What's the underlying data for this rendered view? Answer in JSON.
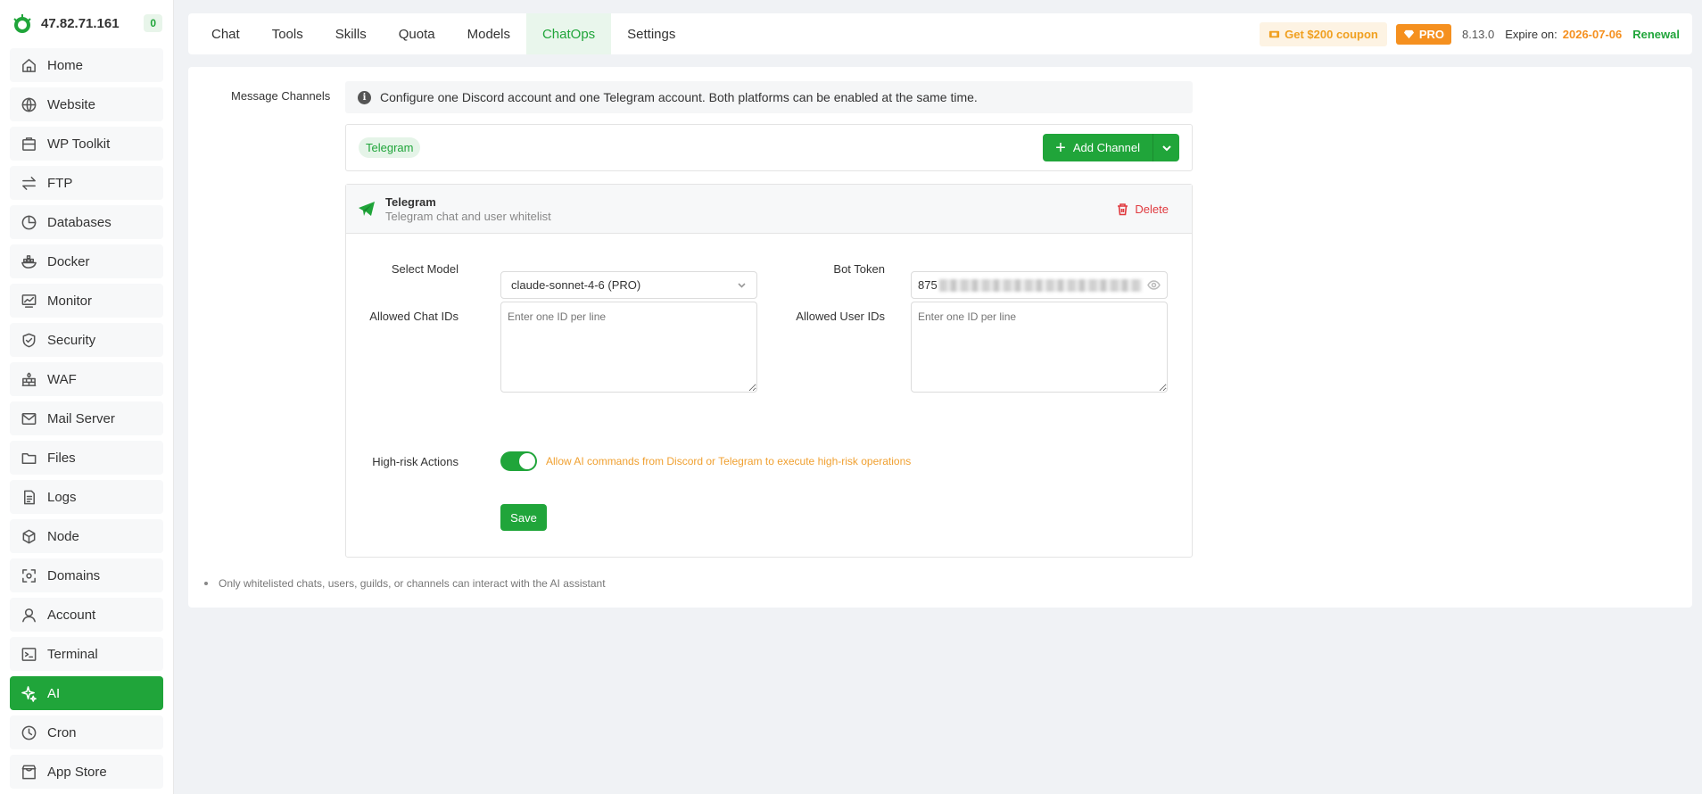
{
  "brand": {
    "ip": "47.82.71.161",
    "badge": "0"
  },
  "sidebar": {
    "items": [
      {
        "label": "Home",
        "icon": "home-icon"
      },
      {
        "label": "Website",
        "icon": "globe-icon"
      },
      {
        "label": "WP Toolkit",
        "icon": "toolkit-icon"
      },
      {
        "label": "FTP",
        "icon": "transfer-icon"
      },
      {
        "label": "Databases",
        "icon": "database-icon"
      },
      {
        "label": "Docker",
        "icon": "docker-icon"
      },
      {
        "label": "Monitor",
        "icon": "monitor-icon"
      },
      {
        "label": "Security",
        "icon": "shield-icon"
      },
      {
        "label": "WAF",
        "icon": "firewall-icon"
      },
      {
        "label": "Mail Server",
        "icon": "mail-icon"
      },
      {
        "label": "Files",
        "icon": "folder-icon"
      },
      {
        "label": "Logs",
        "icon": "log-icon"
      },
      {
        "label": "Node",
        "icon": "node-icon"
      },
      {
        "label": "Domains",
        "icon": "domain-icon"
      },
      {
        "label": "Account",
        "icon": "user-icon"
      },
      {
        "label": "Terminal",
        "icon": "terminal-icon"
      },
      {
        "label": "AI",
        "icon": "sparkle-icon",
        "active": true
      },
      {
        "label": "Cron",
        "icon": "clock-icon"
      },
      {
        "label": "App Store",
        "icon": "store-icon"
      }
    ]
  },
  "header": {
    "tabs": [
      "Chat",
      "Tools",
      "Skills",
      "Quota",
      "Models",
      "ChatOps",
      "Settings"
    ],
    "active_tab": "ChatOps",
    "coupon": "Get $200 coupon",
    "pro": "PRO",
    "version": "8.13.0",
    "expire_label": "Expire on:",
    "expire_date": "2026-07-06",
    "renewal": "Renewal"
  },
  "main": {
    "section_label": "Message Channels",
    "info": "Configure one Discord account and one Telegram account. Both platforms can be enabled at the same time.",
    "channel_chip": "Telegram",
    "add_channel": "Add Channel",
    "card": {
      "title": "Telegram",
      "subtitle": "Telegram chat and user whitelist",
      "delete": "Delete",
      "select_model_label": "Select Model",
      "select_model_value": "claude-sonnet-4-6 (PRO)",
      "bot_token_label": "Bot Token",
      "bot_token_prefix": "875",
      "allowed_chat_label": "Allowed Chat IDs",
      "allowed_chat_placeholder": "Enter one ID per line",
      "allowed_user_label": "Allowed User IDs",
      "allowed_user_placeholder": "Enter one ID per line",
      "high_risk_label": "High-risk Actions",
      "high_risk_enabled": true,
      "high_risk_text": "Allow AI commands from Discord or Telegram to execute high-risk operations",
      "save": "Save"
    },
    "note": "Only whitelisted chats, users, guilds, or channels can interact with the AI assistant"
  },
  "colors": {
    "accent": "#20a53a",
    "warning": "#f5901f",
    "danger": "#e0393e"
  }
}
